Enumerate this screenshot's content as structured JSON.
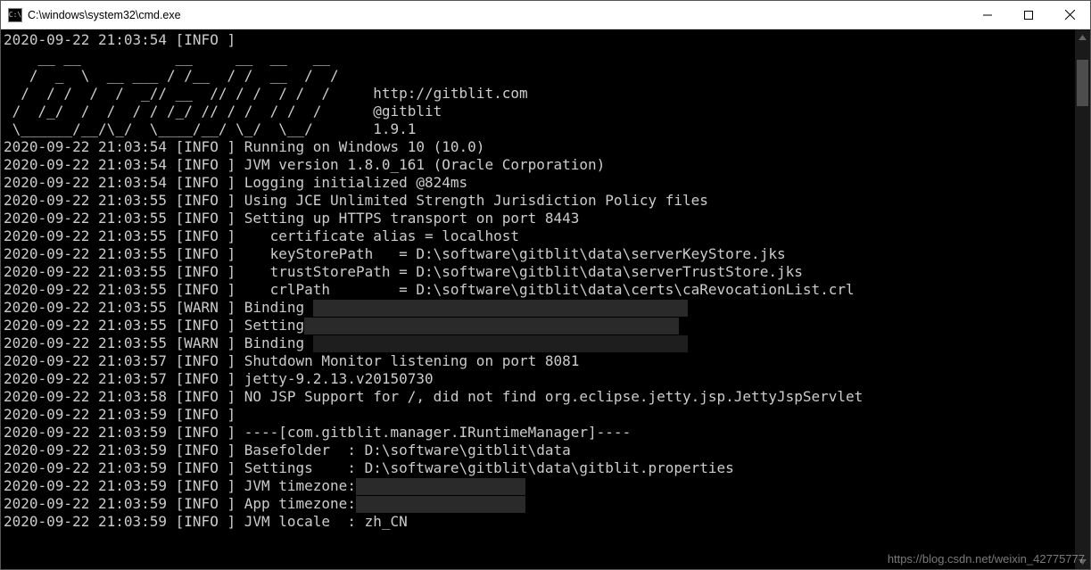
{
  "window": {
    "title": "C:\\windows\\system32\\cmd.exe"
  },
  "ascii_art": {
    "line1": "   __ __         __     __  __ __  ",
    "line2": "  /  _  \\  __ __/ /__  / / /  _  __",
    "line3": " /  /_/  /  /  _   __// / /  / /  /    http://gitblit.com",
    "line4": " \\  \\ /  /  /  //  / / / /  / /  /     @gitblit",
    "line5": "  \\_____/__/\\__/\\___/_/_/__/\\__/       1.9.1",
    "line6": ""
  },
  "log": [
    {
      "ts": "2020-09-22 21:03:54",
      "lvl": "INFO ",
      "msg": ""
    },
    {
      "ts": "2020-09-22 21:03:54",
      "lvl": "INFO ",
      "msg": "Running on Windows 10 (10.0)"
    },
    {
      "ts": "2020-09-22 21:03:54",
      "lvl": "INFO ",
      "msg": "JVM version 1.8.0_161 (Oracle Corporation)"
    },
    {
      "ts": "2020-09-22 21:03:54",
      "lvl": "INFO ",
      "msg": "Logging initialized @824ms"
    },
    {
      "ts": "2020-09-22 21:03:55",
      "lvl": "INFO ",
      "msg": "Using JCE Unlimited Strength Jurisdiction Policy files"
    },
    {
      "ts": "2020-09-22 21:03:55",
      "lvl": "INFO ",
      "msg": "Setting up HTTPS transport on port 8443"
    },
    {
      "ts": "2020-09-22 21:03:55",
      "lvl": "INFO ",
      "msg": "   certificate alias = localhost"
    },
    {
      "ts": "2020-09-22 21:03:55",
      "lvl": "INFO ",
      "msg": "   keyStorePath   = D:\\software\\gitblit\\data\\serverKeyStore.jks"
    },
    {
      "ts": "2020-09-22 21:03:55",
      "lvl": "INFO ",
      "msg": "   trustStorePath = D:\\software\\gitblit\\data\\serverTrustStore.jks"
    },
    {
      "ts": "2020-09-22 21:03:55",
      "lvl": "INFO ",
      "msg": "   crlPath        = D:\\software\\gitblit\\data\\certs\\caRevocationList.crl"
    },
    {
      "ts": "2020-09-22 21:03:55",
      "lvl": "WARN ",
      "msg": "Binding ",
      "redact": true
    },
    {
      "ts": "2020-09-22 21:03:55",
      "lvl": "INFO ",
      "msg": "Setting",
      "redact": true
    },
    {
      "ts": "2020-09-22 21:03:55",
      "lvl": "WARN ",
      "msg": "Binding ",
      "redact": true
    },
    {
      "ts": "2020-09-22 21:03:57",
      "lvl": "INFO ",
      "msg": "Shutdown Monitor listening on port 8081"
    },
    {
      "ts": "2020-09-22 21:03:57",
      "lvl": "INFO ",
      "msg": "jetty-9.2.13.v20150730"
    },
    {
      "ts": "2020-09-22 21:03:58",
      "lvl": "INFO ",
      "msg": "NO JSP Support for /, did not find org.eclipse.jetty.jsp.JettyJspServlet"
    },
    {
      "ts": "2020-09-22 21:03:59",
      "lvl": "INFO ",
      "msg": ""
    },
    {
      "ts": "2020-09-22 21:03:59",
      "lvl": "INFO ",
      "msg": "----[com.gitblit.manager.IRuntimeManager]----"
    },
    {
      "ts": "2020-09-22 21:03:59",
      "lvl": "INFO ",
      "msg": "Basefolder  : D:\\software\\gitblit\\data"
    },
    {
      "ts": "2020-09-22 21:03:59",
      "lvl": "INFO ",
      "msg": "Settings    : D:\\software\\gitblit\\data\\gitblit.properties"
    },
    {
      "ts": "2020-09-22 21:03:59",
      "lvl": "INFO ",
      "msg": "JVM timezone:",
      "redact": true,
      "short": true
    },
    {
      "ts": "2020-09-22 21:03:59",
      "lvl": "INFO ",
      "msg": "App timezone:",
      "redact": true,
      "short": true
    },
    {
      "ts": "2020-09-22 21:03:59",
      "lvl": "INFO ",
      "msg": "JVM locale  : zh_CN"
    }
  ],
  "watermark": "https://blog.csdn.net/weixin_42775777"
}
